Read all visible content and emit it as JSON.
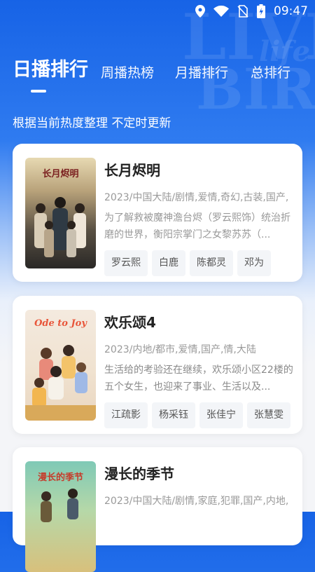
{
  "status": {
    "time": "09:47"
  },
  "tabs": [
    {
      "label": "日播排行"
    },
    {
      "label": "周播热榜"
    },
    {
      "label": "月播排行"
    },
    {
      "label": "总排行"
    }
  ],
  "subtitle": "根据当前热度整理 不定时更新",
  "shows": [
    {
      "title": "长月烬明",
      "poster_title": "长月烬明",
      "genre": "2023/中国大陆/剧情,爱情,奇幻,古装,国产,",
      "desc": "为了解救被魔神澹台烬（罗云熙饰）统治折磨的世界，衡阳宗掌门之女黎苏苏（...",
      "tags": [
        "罗云熙",
        "白鹿",
        "陈都灵",
        "邓为"
      ]
    },
    {
      "title": "欢乐颂4",
      "poster_title": "Ode to Joy",
      "genre": "2023/内地/都市,爱情,国产,情,大陆",
      "desc": "生活给的考验还在继续，欢乐颂小区22楼的五个女生，也迎来了事业、生活以及...",
      "tags": [
        "江疏影",
        "杨采钰",
        "张佳宁",
        "张慧雯"
      ]
    },
    {
      "title": "漫长的季节",
      "poster_title": "漫长的季节",
      "genre": "2023/中国大陆/剧情,家庭,犯罪,国产,内地,",
      "desc": "",
      "tags": []
    }
  ]
}
